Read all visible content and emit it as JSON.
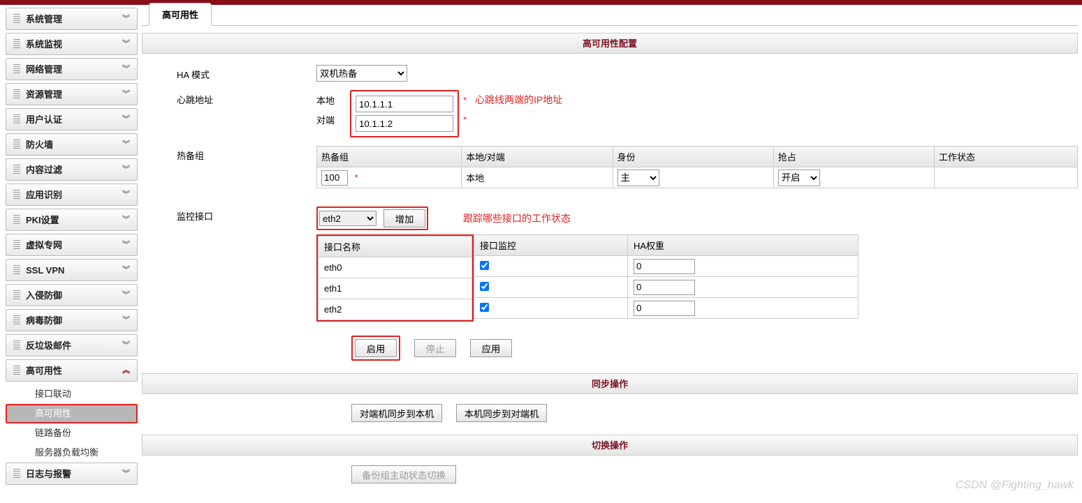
{
  "sidebar": {
    "items": [
      "系统管理",
      "系统监视",
      "网络管理",
      "资源管理",
      "用户认证",
      "防火墙",
      "内容过滤",
      "应用识别",
      "PKI设置",
      "虚拟专网",
      "SSL VPN",
      "入侵防御",
      "病毒防御",
      "反垃圾邮件"
    ],
    "expanded": {
      "label": "高可用性",
      "children": [
        "接口联动",
        "高可用性",
        "链路备份",
        "服务器负载均衡"
      ],
      "active": "高可用性"
    },
    "last": "日志与报警"
  },
  "tab": {
    "title": "高可用性"
  },
  "sections": {
    "config": "高可用性配置",
    "sync": "同步操作",
    "switch": "切换操作"
  },
  "form": {
    "ha_mode_label": "HA 模式",
    "ha_mode_value": "双机热备",
    "heartbeat_label": "心跳地址",
    "local_label": "本地",
    "peer_label": "对端",
    "local_ip": "10.1.1.1",
    "peer_ip": "10.1.1.2",
    "heartbeat_annotation": "心跳线两端的IP地址",
    "group_label": "热备组",
    "monitor_label": "监控接口",
    "monitor_select": "eth2",
    "add_btn": "增加",
    "monitor_annotation": "跟踪哪些接口的工作状态"
  },
  "group_table": {
    "headers": [
      "热备组",
      "本地/对端",
      "身份",
      "抢占",
      "工作状态"
    ],
    "row": {
      "group": "100",
      "side": "本地",
      "role": "主",
      "preempt": "开启",
      "status": ""
    }
  },
  "monitor_table": {
    "headers": [
      "接口名称",
      "接口监控",
      "HA权重"
    ],
    "rows": [
      {
        "name": "eth0",
        "checked": true,
        "weight": "0"
      },
      {
        "name": "eth1",
        "checked": true,
        "weight": "0"
      },
      {
        "name": "eth2",
        "checked": true,
        "weight": "0"
      }
    ]
  },
  "buttons": {
    "enable": "启用",
    "stop": "停止",
    "apply": "应用",
    "sync_from_peer": "对端机同步到本机",
    "sync_to_peer": "本机同步到对端机",
    "switch": "备份组主动状态切换"
  },
  "watermark": "CSDN @Fighting_hawk"
}
